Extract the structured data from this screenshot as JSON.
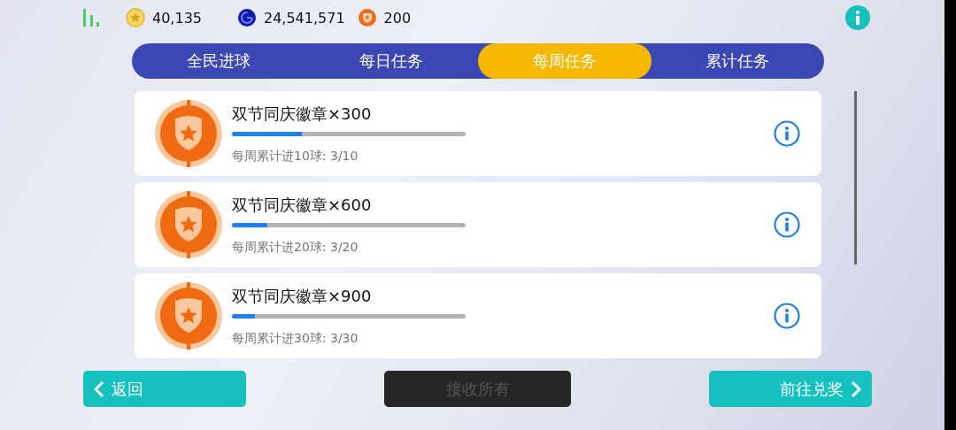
{
  "currencies": [
    {
      "kind": "coin",
      "value": "40,135"
    },
    {
      "kind": "gp",
      "value": "24,541,571"
    },
    {
      "kind": "badge",
      "value": "200"
    }
  ],
  "tabs": [
    {
      "label": "全民进球",
      "selected": false
    },
    {
      "label": "每日任务",
      "selected": false
    },
    {
      "label": "每周任务",
      "selected": true
    },
    {
      "label": "累计任务",
      "selected": false
    }
  ],
  "tasks": [
    {
      "title": "双节同庆徽章×300",
      "level": 0.3,
      "progress": "每周累计进10球: 3/10"
    },
    {
      "title": "双节同庆徽章×600",
      "level": 0.15,
      "progress": "每周累计进20球: 3/20"
    },
    {
      "title": "双节同庆徽章×900",
      "level": 0.1,
      "progress": "每周累计进30球: 3/30"
    }
  ],
  "buttons": {
    "back": {
      "label": "返回"
    },
    "claim_all": {
      "label": "接收所有",
      "disabled": true
    },
    "redeem": {
      "label": "前往兑奖"
    }
  }
}
